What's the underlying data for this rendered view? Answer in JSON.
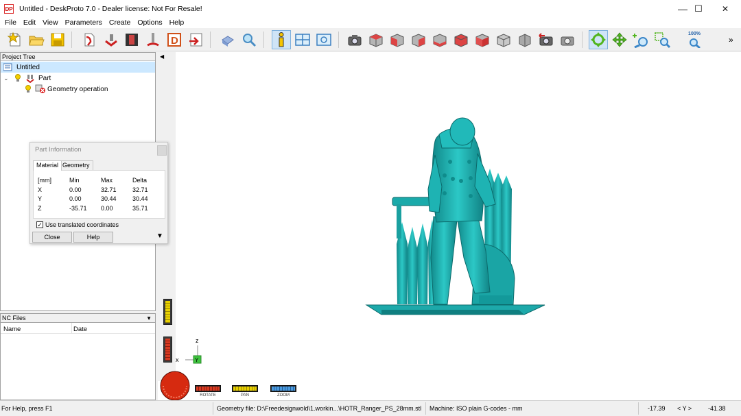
{
  "window": {
    "app_icon_text": "DP",
    "title": "Untitled - DeskProto 7.0 - Dealer license: Not For Resale!",
    "min_label": "—",
    "max_label": "☐",
    "close_label": "✕"
  },
  "menu": [
    "File",
    "Edit",
    "View",
    "Parameters",
    "Create",
    "Options",
    "Help"
  ],
  "toolbar": {
    "zoom_label": "100%",
    "more_label": "»"
  },
  "project_tree": {
    "header": "Project Tree",
    "items": [
      {
        "label": "Untitled"
      },
      {
        "label": "Part"
      },
      {
        "label": "Geometry operation"
      }
    ]
  },
  "nc_files": {
    "header": "NC Files",
    "columns": [
      "Name",
      "Date"
    ]
  },
  "part_info": {
    "title": "Part Information",
    "tabs": [
      "Material",
      "Geometry"
    ],
    "headers": [
      "[mm]",
      "Min",
      "Max",
      "Delta"
    ],
    "rows": [
      [
        "X",
        "0.00",
        "32.71",
        "32.71"
      ],
      [
        "Y",
        "0.00",
        "30.44",
        "30.44"
      ],
      [
        "Z",
        "-35.71",
        "0.00",
        "35.71"
      ]
    ],
    "checkbox_label": "Use translated coordinates",
    "checkbox_checked": true,
    "close_button": "Close",
    "help_button": "Help"
  },
  "view_controls": {
    "rotate_label": "ROTATE",
    "pan_label": "PAN",
    "zoom_label": "ZOOM",
    "axis_z": "z",
    "axis_x": "x",
    "axis_y": "Y"
  },
  "status": {
    "help": "For Help, press F1",
    "geometry_file": "Geometry file: D:\\Freedesignwold\\1.workin...\\HOTR_Ranger_PS_28mm.stl",
    "machine": "Machine: ISO plain G-codes - mm",
    "coord_a": "-17.39",
    "coord_label": "< Y >",
    "coord_b": "-41.38"
  },
  "colors": {
    "model": "#1fb5b5",
    "model_dark": "#0f7f80",
    "selection": "#cce8ff",
    "toolbar_pressed": "#cfe4f7"
  }
}
